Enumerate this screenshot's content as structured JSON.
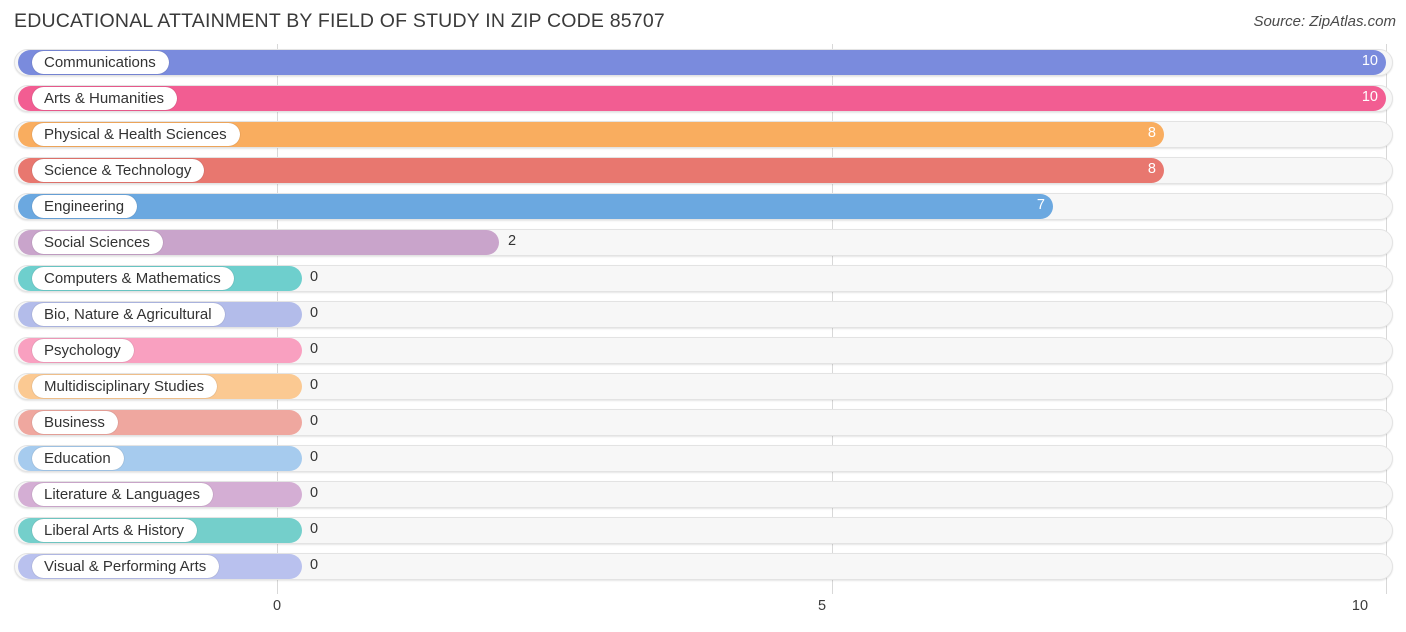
{
  "header": {
    "title": "EDUCATIONAL ATTAINMENT BY FIELD OF STUDY IN ZIP CODE 85707",
    "source": "Source: ZipAtlas.com"
  },
  "chart_data": {
    "type": "bar",
    "orientation": "horizontal",
    "title": "EDUCATIONAL ATTAINMENT BY FIELD OF STUDY IN ZIP CODE 85707",
    "xlabel": "",
    "ylabel": "",
    "xlim": [
      0,
      10
    ],
    "grid": true,
    "legend": false,
    "xticks": [
      "0",
      "5",
      "10"
    ],
    "xtick_values": [
      0,
      5,
      10
    ],
    "categories": [
      "Communications",
      "Arts & Humanities",
      "Physical & Health Sciences",
      "Science & Technology",
      "Engineering",
      "Social Sciences",
      "Computers & Mathematics",
      "Bio, Nature & Agricultural",
      "Psychology",
      "Multidisciplinary Studies",
      "Business",
      "Education",
      "Literature & Languages",
      "Liberal Arts & History",
      "Visual & Performing Arts"
    ],
    "values": [
      10,
      10,
      8,
      8,
      7,
      2,
      0,
      0,
      0,
      0,
      0,
      0,
      0,
      0,
      0
    ],
    "value_labels": [
      "10",
      "10",
      "8",
      "8",
      "7",
      "2",
      "0",
      "0",
      "0",
      "0",
      "0",
      "0",
      "0",
      "0",
      "0"
    ],
    "colors": [
      "#7a8bdd",
      "#f25d92",
      "#f9ad5f",
      "#e8776f",
      "#6ba8e0",
      "#c9a4cb",
      "#6ecfcd",
      "#b3bcea",
      "#f9a0c0",
      "#fbc992",
      "#efa79f",
      "#a6cbee",
      "#d4aed4",
      "#74cfcb",
      "#b9c1ee"
    ]
  }
}
